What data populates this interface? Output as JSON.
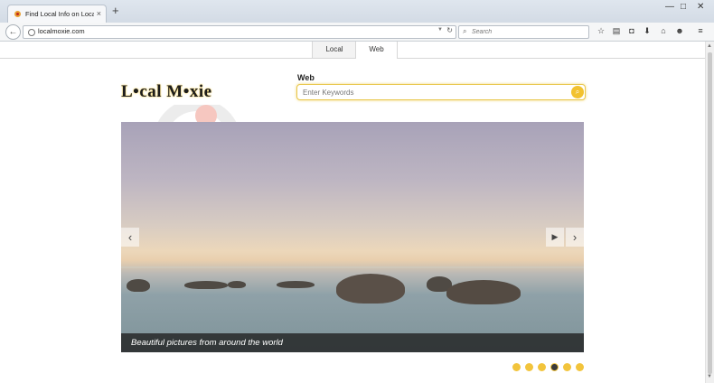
{
  "browser": {
    "tab_title": "Find Local Info on LocalMo...",
    "tab_close": "×",
    "new_tab": "+",
    "window_controls": [
      "—",
      "□",
      "✕"
    ],
    "url": "localmoxie.com",
    "search_placeholder": "Search",
    "toolbar_icons": [
      "star-icon",
      "clipboard-icon",
      "pocket-icon",
      "download-icon",
      "home-icon",
      "chat-icon",
      "menu-icon"
    ]
  },
  "site": {
    "tabs": [
      "Local",
      "Web"
    ],
    "active_tab": "Web",
    "logo_text": "L•cal M•xie",
    "search_label": "Web",
    "search_placeholder": "Enter Keywords",
    "slide_caption": "Beautiful pictures from around the world",
    "carousel_dots": 6,
    "carousel_active_dot": 4
  },
  "colors": {
    "accent": "#f2c43c"
  }
}
